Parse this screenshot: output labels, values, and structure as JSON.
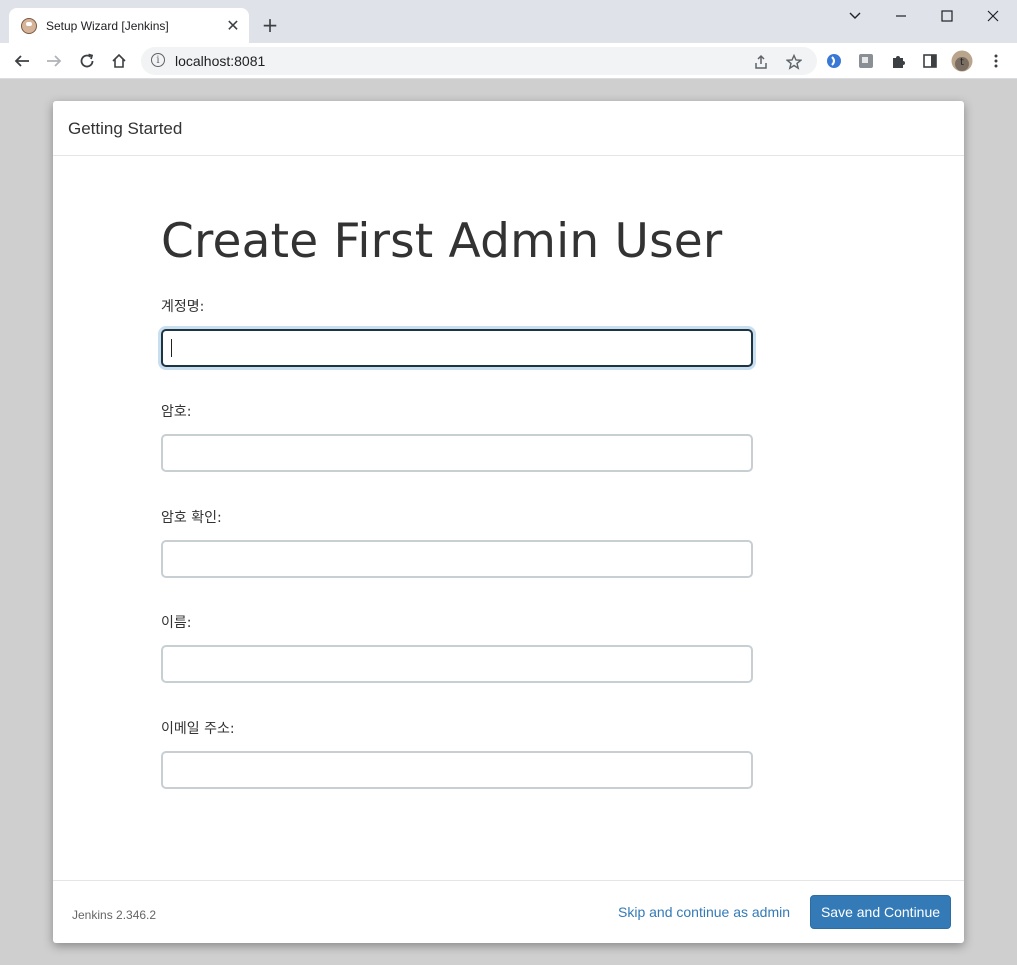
{
  "browser": {
    "tab_title": "Setup Wizard [Jenkins]",
    "url": "localhost:8081"
  },
  "wizard": {
    "header_title": "Getting Started",
    "heading": "Create First Admin User",
    "fields": [
      {
        "label": "계정명:",
        "value": ""
      },
      {
        "label": "암호:",
        "value": ""
      },
      {
        "label": "암호 확인:",
        "value": ""
      },
      {
        "label": "이름:",
        "value": ""
      },
      {
        "label": "이메일 주소:",
        "value": ""
      }
    ],
    "version": "Jenkins 2.346.2",
    "skip_label": "Skip and continue as admin",
    "save_label": "Save and Continue"
  },
  "colors": {
    "accent": "#337ab7",
    "focus_border": "#1d3443"
  }
}
